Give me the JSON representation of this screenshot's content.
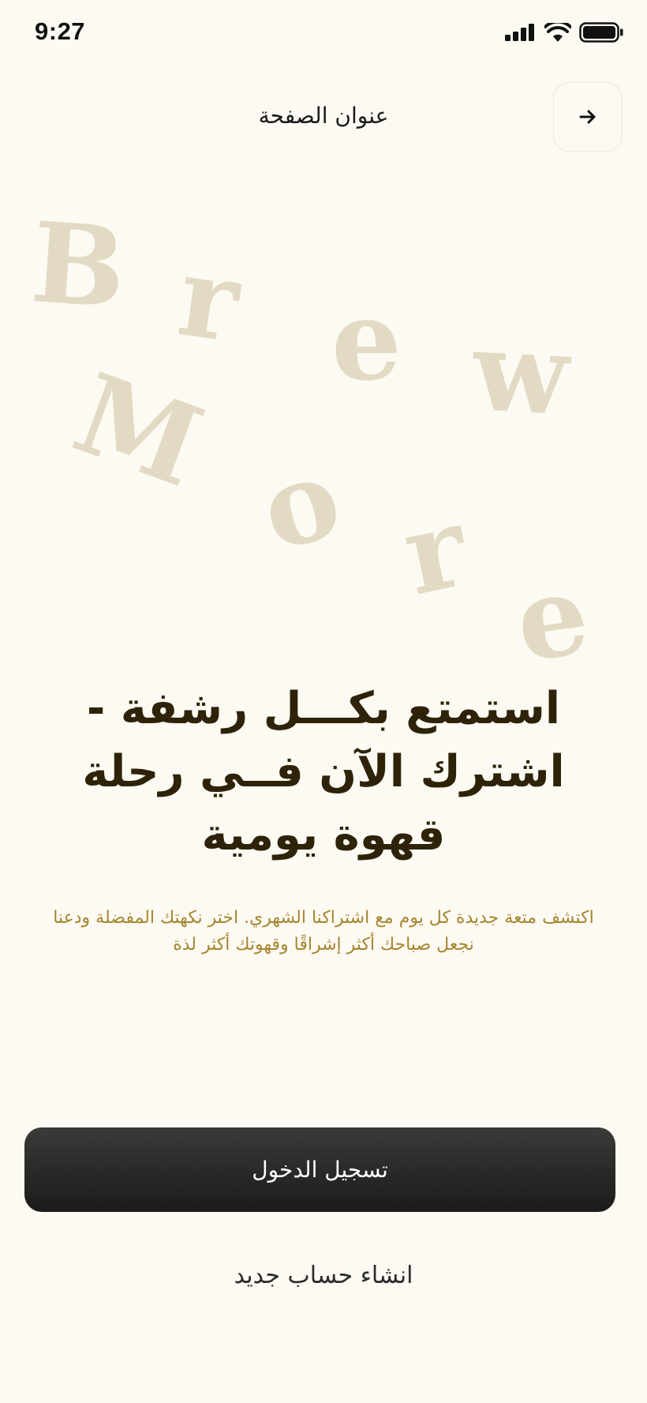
{
  "status_bar": {
    "time": "9:27"
  },
  "header": {
    "title": "عنوان الصفحة",
    "back_icon": "arrow-right-icon"
  },
  "hero_art": {
    "letters": [
      "B",
      "r",
      "e",
      "w",
      "M",
      "o",
      "r",
      "e"
    ],
    "color": "#E3DAC4"
  },
  "headline": "استمتع بكـــل رشفة - اشترك الآن فــي رحلة قهوة يومية",
  "description": "اكتشف متعة جديدة كل يوم مع اشتراكنا الشهري. اختر نكهتك المفضلة ودعنا نجعل صباحك أكثر إشراقًا وقهوتك أكثر لذة",
  "actions": {
    "login_label": "تسجيل الدخول",
    "create_account_label": "انشاء حساب جديد"
  },
  "colors": {
    "background": "#FCFAF2",
    "headline": "#2E2309",
    "description": "#A6852F",
    "button": "#1F1E1C"
  }
}
